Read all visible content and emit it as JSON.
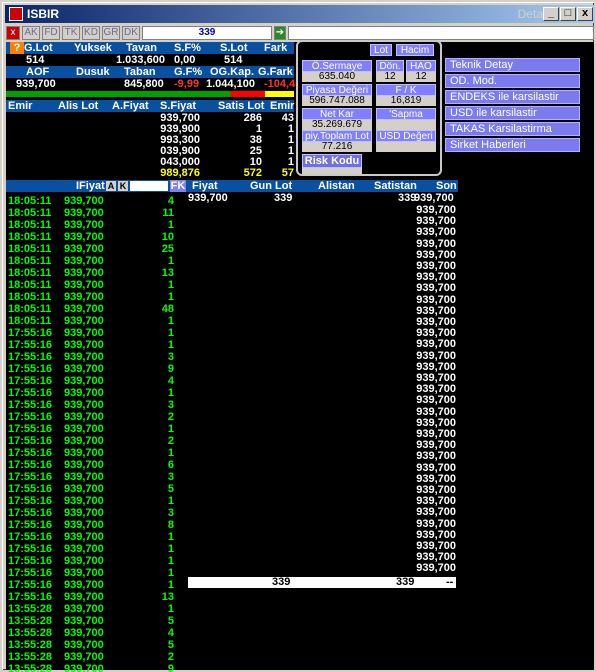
{
  "window": {
    "title": "ISBIR",
    "detail": "Detay",
    "min": "_",
    "max": "□",
    "close": "x"
  },
  "toolbar": {
    "tabs": [
      "AK",
      "FD",
      "TK",
      "KD",
      "GR",
      "DK"
    ],
    "field_value": "339"
  },
  "stats_header1": [
    "G.Lot",
    "Yuksek",
    "Tavan",
    "S.F%",
    "S.Lot",
    "Fark"
  ],
  "stats_values1": [
    "514",
    "",
    "1.033,600",
    "0,00",
    "514",
    ""
  ],
  "stats_header2": [
    "AOF",
    "Dusuk",
    "Taban",
    "G.F%",
    "OG.Kap.",
    "G.Fark"
  ],
  "stats_values2": [
    "939,700",
    "",
    "845,800",
    "-9,99",
    "1.044,100",
    "-104,40"
  ],
  "depth_header": [
    "Emir",
    "Alis Lot",
    "A.Fiyat",
    "S.Fiyat",
    "Satis Lot",
    "Emir"
  ],
  "depth_rows": [
    {
      "sfiyat": "939,700",
      "slot": "286",
      "emir": "43"
    },
    {
      "sfiyat": "939,900",
      "slot": "1",
      "emir": "1"
    },
    {
      "sfiyat": "993,300",
      "slot": "38",
      "emir": "1"
    },
    {
      "sfiyat": "039,900",
      "slot": "25",
      "emir": "1"
    },
    {
      "sfiyat": "043,000",
      "slot": "10",
      "emir": "1"
    },
    {
      "sfiyat": "989,876",
      "slot": "572",
      "emir": "57"
    }
  ],
  "panel": {
    "lot": "Lot",
    "hacim": "Hacim",
    "osermaye_label": "Ö.Sermaye",
    "osermaye": "635.040",
    "don_label": "Dön.",
    "don": "12",
    "hao_label": "HAO",
    "hao": "12",
    "piyasa_label": "Piyasa Değeri",
    "piyasa": "596.747.088",
    "fk_label": "F / K",
    "fk": "16,819",
    "netkar_label": "Net Kar",
    "netkar": "35.269.679",
    "sapma_label": "'Sapma",
    "sapma": "",
    "piytoplam_label": "piy.Toplam Lot",
    "piytoplam": "77.216",
    "usd_label": "USD Değeri",
    "usd": "",
    "risk_label": "Risk Kodu"
  },
  "menu": [
    "Teknik Detay",
    "OD. Mod.",
    "ENDEKS ile karsilastir",
    "USD ile karsilastir",
    "TAKAS Karsilastirma",
    "Sirket Haberleri"
  ],
  "trade_header": {
    "ifiyat": "IFiyat",
    "a": "A",
    "k": "K",
    "fk": "FK",
    "fiyat": "Fiyat",
    "gunlot": "Gun Lot",
    "alistan": "Alistan",
    "satistan": "Satistan",
    "son": "Son"
  },
  "mid_first_row": {
    "fiyat": "939,700",
    "gunlot": "339",
    "satistan": "339",
    "son": "939,700"
  },
  "son_values": [
    "939,700",
    "939,700",
    "939,700",
    "939,700",
    "939,700",
    "939,700",
    "939,700",
    "939,700",
    "939,700",
    "939,700",
    "939,700",
    "939,700",
    "939,700",
    "939,700",
    "939,700",
    "939,700",
    "939,700",
    "939,700",
    "939,700",
    "939,700",
    "939,700",
    "939,700",
    "939,700",
    "939,700",
    "939,700",
    "939,700",
    "939,700",
    "939,700",
    "939,700",
    "939,700",
    "939,700",
    "939,700",
    "939,700"
  ],
  "white_row": {
    "a": "339",
    "b": "339",
    "c": "--"
  },
  "trades": [
    {
      "t": "18:05:11",
      "p": "939,700",
      "q": "4"
    },
    {
      "t": "18:05:11",
      "p": "939,700",
      "q": "11"
    },
    {
      "t": "18:05:11",
      "p": "939,700",
      "q": "1"
    },
    {
      "t": "18:05:11",
      "p": "939,700",
      "q": "10"
    },
    {
      "t": "18:05:11",
      "p": "939,700",
      "q": "25"
    },
    {
      "t": "18:05:11",
      "p": "939,700",
      "q": "1"
    },
    {
      "t": "18:05:11",
      "p": "939,700",
      "q": "13"
    },
    {
      "t": "18:05:11",
      "p": "939,700",
      "q": "1"
    },
    {
      "t": "18:05:11",
      "p": "939,700",
      "q": "1"
    },
    {
      "t": "18:05:11",
      "p": "939,700",
      "q": "48"
    },
    {
      "t": "18:05:11",
      "p": "939,700",
      "q": "1"
    },
    {
      "t": "17:55:16",
      "p": "939,700",
      "q": "1"
    },
    {
      "t": "17:55:16",
      "p": "939,700",
      "q": "1"
    },
    {
      "t": "17:55:16",
      "p": "939,700",
      "q": "3"
    },
    {
      "t": "17:55:16",
      "p": "939,700",
      "q": "9"
    },
    {
      "t": "17:55:16",
      "p": "939,700",
      "q": "4"
    },
    {
      "t": "17:55:16",
      "p": "939,700",
      "q": "1"
    },
    {
      "t": "17:55:16",
      "p": "939,700",
      "q": "3"
    },
    {
      "t": "17:55:16",
      "p": "939,700",
      "q": "2"
    },
    {
      "t": "17:55:16",
      "p": "939,700",
      "q": "1"
    },
    {
      "t": "17:55:16",
      "p": "939,700",
      "q": "2"
    },
    {
      "t": "17:55:16",
      "p": "939,700",
      "q": "1"
    },
    {
      "t": "17:55:16",
      "p": "939,700",
      "q": "6"
    },
    {
      "t": "17:55:16",
      "p": "939,700",
      "q": "3"
    },
    {
      "t": "17:55:16",
      "p": "939,700",
      "q": "5"
    },
    {
      "t": "17:55:16",
      "p": "939,700",
      "q": "1"
    },
    {
      "t": "17:55:16",
      "p": "939,700",
      "q": "3"
    },
    {
      "t": "17:55:16",
      "p": "939,700",
      "q": "8"
    },
    {
      "t": "17:55:16",
      "p": "939,700",
      "q": "1"
    },
    {
      "t": "17:55:16",
      "p": "939,700",
      "q": "1"
    },
    {
      "t": "17:55:16",
      "p": "939,700",
      "q": "1"
    },
    {
      "t": "17:55:16",
      "p": "939,700",
      "q": "1"
    },
    {
      "t": "17:55:16",
      "p": "939,700",
      "q": "1"
    },
    {
      "t": "17:55:16",
      "p": "939,700",
      "q": "13"
    },
    {
      "t": "13:55:28",
      "p": "939,700",
      "q": "1"
    },
    {
      "t": "13:55:28",
      "p": "939,700",
      "q": "5"
    },
    {
      "t": "13:55:28",
      "p": "939,700",
      "q": "4"
    },
    {
      "t": "13:55:28",
      "p": "939,700",
      "q": "5"
    },
    {
      "t": "13:55:28",
      "p": "939,700",
      "q": "2"
    },
    {
      "t": "13:55:28",
      "p": "939,700",
      "q": "9"
    },
    {
      "t": "13:55:28",
      "p": "939,700",
      "q": "1"
    }
  ]
}
